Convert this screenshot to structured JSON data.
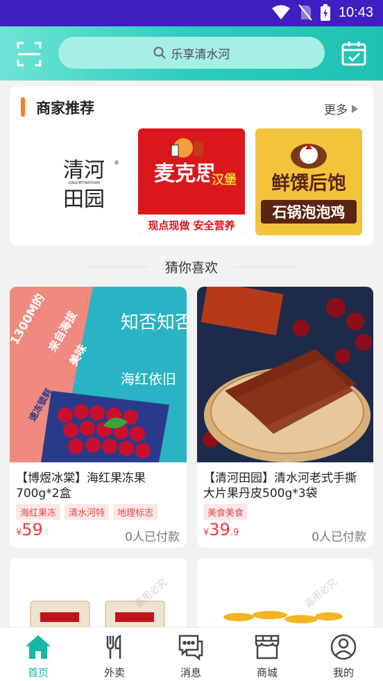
{
  "status_bar": {
    "time": "10:43"
  },
  "header": {
    "search_placeholder": "乐享清水河"
  },
  "merchants": {
    "title": "商家推荐",
    "more": "更多",
    "logos": [
      {
        "name": "清河田园",
        "sub": "QINGHETIANYUAN"
      },
      {
        "name": "麦克思",
        "tag": "汉堡",
        "slogan": "现点现做 安全营养"
      },
      {
        "name": "鲜馔后饱",
        "sub": "石锅泡泡鸡"
      }
    ]
  },
  "guess": {
    "title": "猜你喜欢"
  },
  "products": [
    {
      "name": "【博煜冰棠】海红果冻果700g*2盒",
      "tags": [
        "海红果冻",
        "清水河特",
        "地理标志"
      ],
      "currency": "¥",
      "price_int": "59",
      "price_dec": "",
      "paid": "0人已付款",
      "image_text": [
        "1300M的",
        "来自海拔",
        "美味",
        "速冻锁鲜",
        "知否知否",
        "海红依旧"
      ]
    },
    {
      "name": "【清河田园】清水河老式手撕大片果丹皮500g*3袋",
      "tags": [
        "美食美食"
      ],
      "currency": "¥",
      "price_int": "39",
      "price_dec": ".9",
      "paid": "0人已付款"
    }
  ],
  "watermark": "盗用必究",
  "tabbar": [
    {
      "label": "首页",
      "icon": "home-icon",
      "active": true
    },
    {
      "label": "外卖",
      "icon": "utensils-icon",
      "active": false
    },
    {
      "label": "消息",
      "icon": "chat-icon",
      "active": false
    },
    {
      "label": "商城",
      "icon": "store-icon",
      "active": false
    },
    {
      "label": "我的",
      "icon": "user-icon",
      "active": false
    }
  ],
  "colors": {
    "accent": "#1fc2b2",
    "status_bar": "#3f1ec2",
    "price": "#ef3b3b",
    "title_bar": "#f47f24"
  }
}
